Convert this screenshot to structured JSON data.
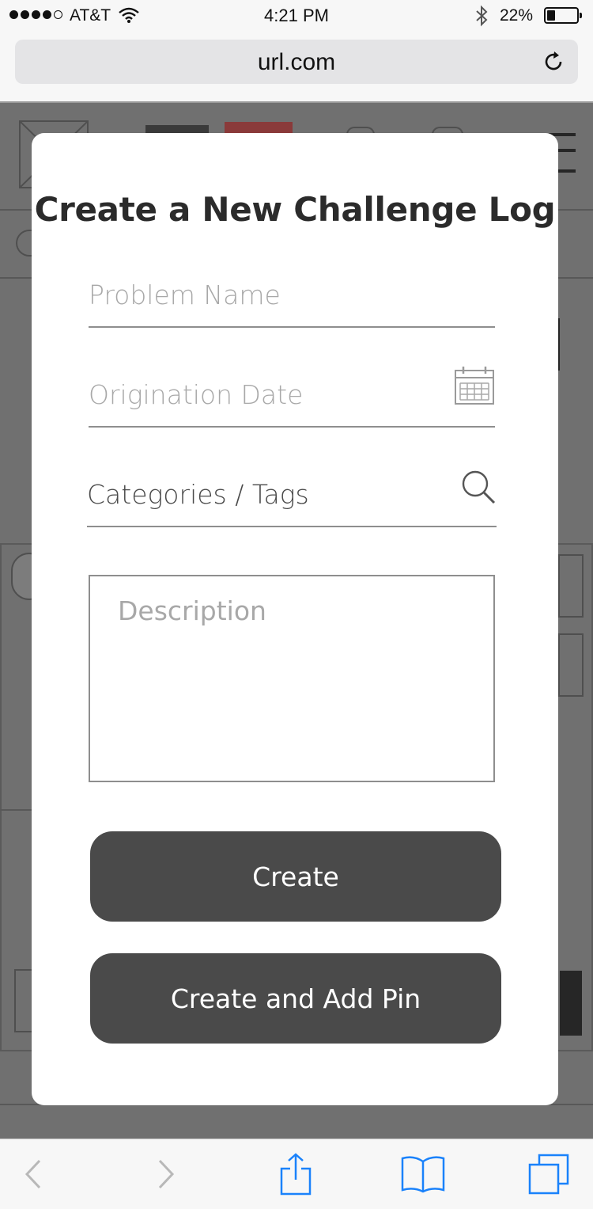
{
  "status_bar": {
    "carrier": "AT&T",
    "time": "4:21 PM",
    "battery_pct": "22%",
    "signal_bars_filled": 4,
    "signal_bars_total": 5,
    "battery_level": 0.22
  },
  "browser": {
    "url": "url.com",
    "reload_icon": "reload-icon"
  },
  "modal": {
    "title": "Create a New Challenge Log",
    "problem_name_placeholder": "Problem Name",
    "origination_date_placeholder": "Origination Date",
    "categories_placeholder": "Categories / Tags",
    "description_placeholder": "Description",
    "create_label": "Create",
    "create_pin_label": "Create and Add Pin",
    "calendar_icon": "calendar-icon",
    "search_icon": "search-icon"
  },
  "toolbar": {
    "icons": [
      "back-icon",
      "forward-icon",
      "share-icon",
      "bookmarks-icon",
      "tabs-icon"
    ],
    "accent": "#1a82fb",
    "disabled": "#b8b8b8"
  },
  "colors": {
    "button_bg": "#4a4a4a",
    "overlay_bg": "#707070",
    "field_border": "#8e8e8e"
  }
}
